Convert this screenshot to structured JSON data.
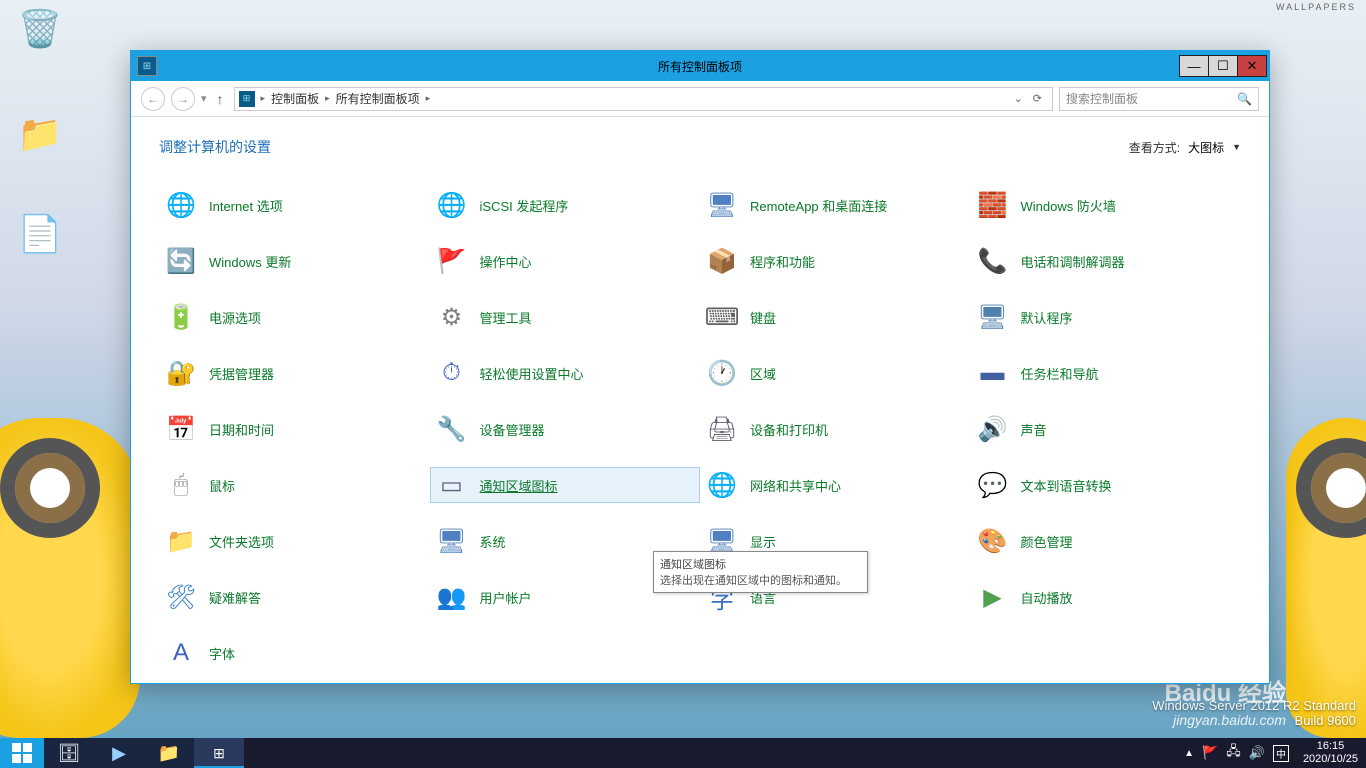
{
  "wallpaper_tag": "WALLPAPERS",
  "system_info": {
    "edition": "Windows Server 2012 R2 Standard",
    "build": "Build 9600"
  },
  "watermark": {
    "brand": "Baidu 经验",
    "url": "jingyan.baidu.com"
  },
  "desktop": {
    "recycle": "",
    "folder": "",
    "textfile": ""
  },
  "window": {
    "title": "所有控制面板项",
    "breadcrumb": {
      "root": "控制面板",
      "current": "所有控制面板项"
    },
    "search_placeholder": "搜索控制面板",
    "adjust_label": "调整计算机的设置",
    "view_by_label": "查看方式:",
    "view_by_value": "大图标"
  },
  "tooltip": {
    "title": "通知区域图标",
    "body": "选择出现在通知区域中的图标和通知。"
  },
  "items": [
    {
      "label": "Internet 选项",
      "icon": "🌐",
      "cls": "ic-globe",
      "name": "internet-options"
    },
    {
      "label": "iSCSI 发起程序",
      "icon": "🌐",
      "cls": "ic-isc",
      "name": "iscsi-initiator"
    },
    {
      "label": "RemoteApp 和桌面连接",
      "icon": "🖥",
      "cls": "ic-rem",
      "name": "remoteapp"
    },
    {
      "label": "Windows 防火墙",
      "icon": "🧱",
      "cls": "ic-fire",
      "name": "windows-firewall"
    },
    {
      "label": "Windows 更新",
      "icon": "🔄",
      "cls": "ic-update",
      "name": "windows-update"
    },
    {
      "label": "操作中心",
      "icon": "🚩",
      "cls": "ic-flag",
      "name": "action-center"
    },
    {
      "label": "程序和功能",
      "icon": "📦",
      "cls": "ic-prog",
      "name": "programs-features"
    },
    {
      "label": "电话和调制解调器",
      "icon": "📞",
      "cls": "ic-phone",
      "name": "phone-modem"
    },
    {
      "label": "电源选项",
      "icon": "🔋",
      "cls": "ic-power",
      "name": "power-options"
    },
    {
      "label": "管理工具",
      "icon": "⚙",
      "cls": "ic-gear",
      "name": "admin-tools"
    },
    {
      "label": "键盘",
      "icon": "⌨",
      "cls": "ic-kbd",
      "name": "keyboard"
    },
    {
      "label": "默认程序",
      "icon": "🖥",
      "cls": "ic-prog",
      "name": "default-programs"
    },
    {
      "label": "凭据管理器",
      "icon": "🔐",
      "cls": "ic-key",
      "name": "credential-manager"
    },
    {
      "label": "轻松使用设置中心",
      "icon": "⏱",
      "cls": "ic-ease",
      "name": "ease-of-access"
    },
    {
      "label": "区域",
      "icon": "🕐",
      "cls": "ic-reg",
      "name": "region"
    },
    {
      "label": "任务栏和导航",
      "icon": "▬",
      "cls": "ic-task",
      "name": "taskbar-nav"
    },
    {
      "label": "日期和时间",
      "icon": "📅",
      "cls": "ic-cal",
      "name": "date-time"
    },
    {
      "label": "设备管理器",
      "icon": "🔧",
      "cls": "ic-dev",
      "name": "device-manager"
    },
    {
      "label": "设备和打印机",
      "icon": "🖨",
      "cls": "ic-print",
      "name": "devices-printers"
    },
    {
      "label": "声音",
      "icon": "🔊",
      "cls": "ic-sound",
      "name": "sound"
    },
    {
      "label": "鼠标",
      "icon": "🖱",
      "cls": "ic-mouse",
      "name": "mouse"
    },
    {
      "label": "通知区域图标",
      "icon": "▭",
      "cls": "ic-notif",
      "name": "notification-area-icons",
      "hovered": true
    },
    {
      "label": "网络和共享中心",
      "icon": "🌐",
      "cls": "ic-net",
      "name": "network-sharing"
    },
    {
      "label": "文本到语音转换",
      "icon": "💬",
      "cls": "ic-text",
      "name": "text-to-speech"
    },
    {
      "label": "文件夹选项",
      "icon": "📁",
      "cls": "ic-folder",
      "name": "folder-options"
    },
    {
      "label": "系统",
      "icon": "🖥",
      "cls": "ic-sys",
      "name": "system"
    },
    {
      "label": "显示",
      "icon": "🖥",
      "cls": "ic-sys",
      "name": "display"
    },
    {
      "label": "颜色管理",
      "icon": "🎨",
      "cls": "ic-color",
      "name": "color-management"
    },
    {
      "label": "疑难解答",
      "icon": "🛠",
      "cls": "ic-help",
      "name": "troubleshooting"
    },
    {
      "label": "用户帐户",
      "icon": "👥",
      "cls": "ic-user",
      "name": "user-accounts"
    },
    {
      "label": "语言",
      "icon": "字",
      "cls": "ic-lang",
      "name": "language"
    },
    {
      "label": "自动播放",
      "icon": "▶",
      "cls": "ic-auto",
      "name": "autoplay"
    },
    {
      "label": "字体",
      "icon": "A",
      "cls": "ic-font",
      "name": "fonts"
    }
  ],
  "taskbar": {
    "time": "16:15",
    "date": "2020/10/25",
    "ime": "中"
  }
}
